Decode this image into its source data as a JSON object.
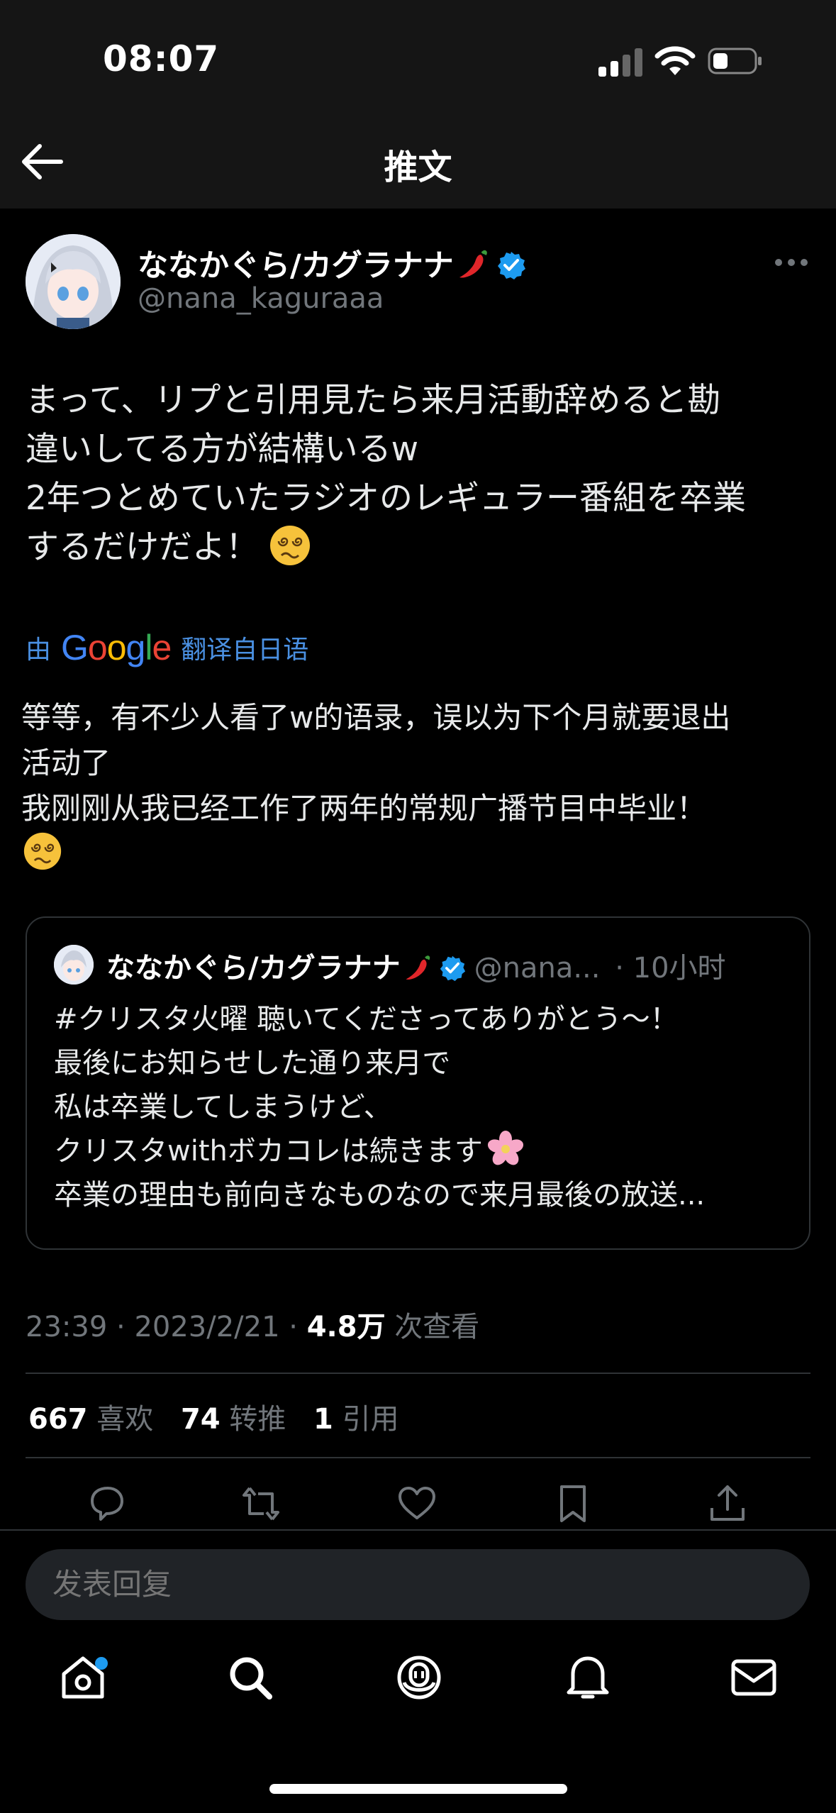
{
  "status_bar": {
    "time": "08:07"
  },
  "header": {
    "title": "推文"
  },
  "author": {
    "name": "ななかぐら/カグラナナ",
    "handle": "@nana_kaguraaa"
  },
  "tweet": {
    "lines": [
      "まって、リプと引用見たら来月活動辞めると勘",
      "違いしてる方が結構いるw",
      "2年つとめていたラジオのレギュラー番組を卒業",
      "するだけだよ！"
    ]
  },
  "translation": {
    "prefix": "由",
    "brand": "Google",
    "suffix": "翻译自日语",
    "lines": [
      "等等，有不少人看了w的语录，误以为下个月就要退出",
      "活动了",
      "我刚刚从我已经工作了两年的常规广播节目中毕业！"
    ]
  },
  "quote": {
    "name": "ななかぐら/カグラナナ",
    "handle": "@nana...",
    "time": "· 10小时",
    "lines": [
      "#クリスタ火曜 聴いてくださってありがとう～！",
      "最後にお知らせした通り来月で",
      "私は卒業してしまうけど、",
      "クリスタwithボカコレは続きます",
      "卒業の理由も前向きなものなので来月最後の放送..."
    ]
  },
  "meta": {
    "time": "23:39",
    "date": "2023/2/21",
    "views": "4.8万",
    "views_label": "次查看",
    "sep": "·"
  },
  "stats": {
    "likes": "667",
    "likes_label": "喜欢",
    "retweets": "74",
    "retweets_label": "转推",
    "quotes": "1",
    "quotes_label": "引用"
  },
  "reply": {
    "placeholder": "发表回复"
  },
  "colors": {
    "accent": "#1d9bf0",
    "link": "#4a90e2",
    "muted": "#71767b",
    "background": "#000000"
  },
  "icons": [
    "back-arrow-icon",
    "verified-icon",
    "chili-pepper-icon",
    "more-icon",
    "dizzy-face-icon",
    "cherry-blossom-icon",
    "reply-icon",
    "retweet-icon",
    "like-icon",
    "bookmark-icon",
    "share-icon",
    "home-icon",
    "search-icon",
    "spaces-icon",
    "notifications-icon",
    "messages-icon"
  ]
}
